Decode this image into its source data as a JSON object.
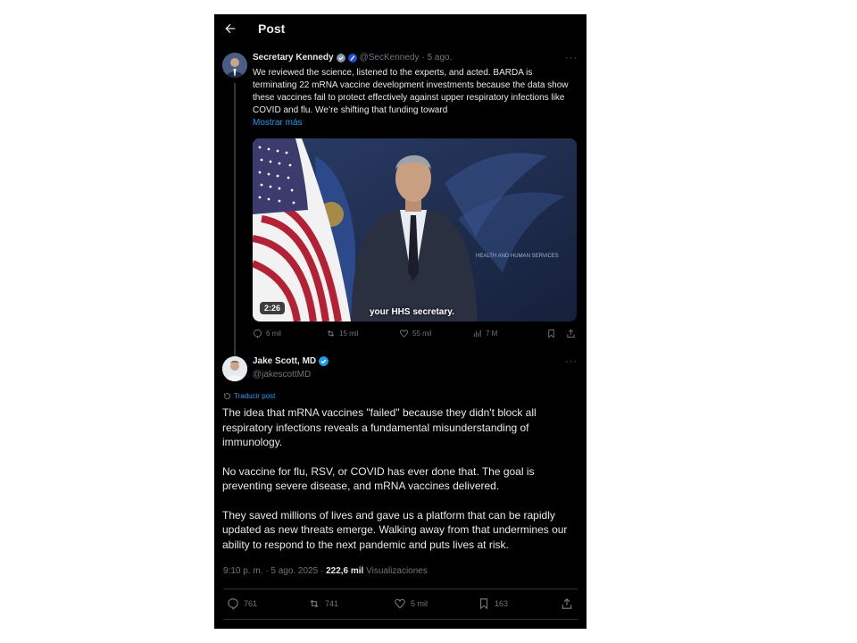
{
  "header": {
    "title": "Post"
  },
  "tweet1": {
    "name": "Secretary Kennedy",
    "handle": "@SecKennedy",
    "date": "· 5 ago.",
    "text": "We reviewed the science, listened to the experts, and acted. BARDA is terminating 22 mRNA vaccine development investments because the data show these vaccines fail to protect effectively against upper respiratory infections like COVID and flu. We’re shifting that funding toward",
    "show_more": "Mostrar más",
    "video": {
      "duration": "2:26",
      "caption": "your HHS secretary.",
      "watermark": "HEALTH AND HUMAN SERVICES"
    },
    "stats": {
      "replies": "6 mil",
      "reposts": "15 mil",
      "likes": "55 mil",
      "views": "7 M"
    }
  },
  "tweet2": {
    "name": "Jake Scott, MD",
    "handle": "@jakescottMD",
    "translate": "Traducir post",
    "paragraphs": [
      "The idea that mRNA vaccines \"failed\" because they didn't block all respiratory infections reveals a fundamental misunderstanding of immunology.",
      "No vaccine for flu, RSV, or COVID has ever done that. The goal is preventing severe disease, and mRNA vaccines delivered.",
      "They saved millions of lives and gave us a platform that can be rapidly updated as new threats emerge. Walking away from that undermines our ability to respond to the next pandemic and puts lives at risk."
    ],
    "timestamp": "9:10 p. m. · 5 ago. 2025 · ",
    "views_count": "222,6 mil",
    "views_label": " Visualizaciones",
    "stats": {
      "replies": "761",
      "reposts": "741",
      "likes": "5 mil",
      "bookmarks": "163"
    }
  },
  "colors": {
    "background": "#000000",
    "accent": "#1d9bf0",
    "muted": "#71767b",
    "text": "#e7e9ea"
  }
}
